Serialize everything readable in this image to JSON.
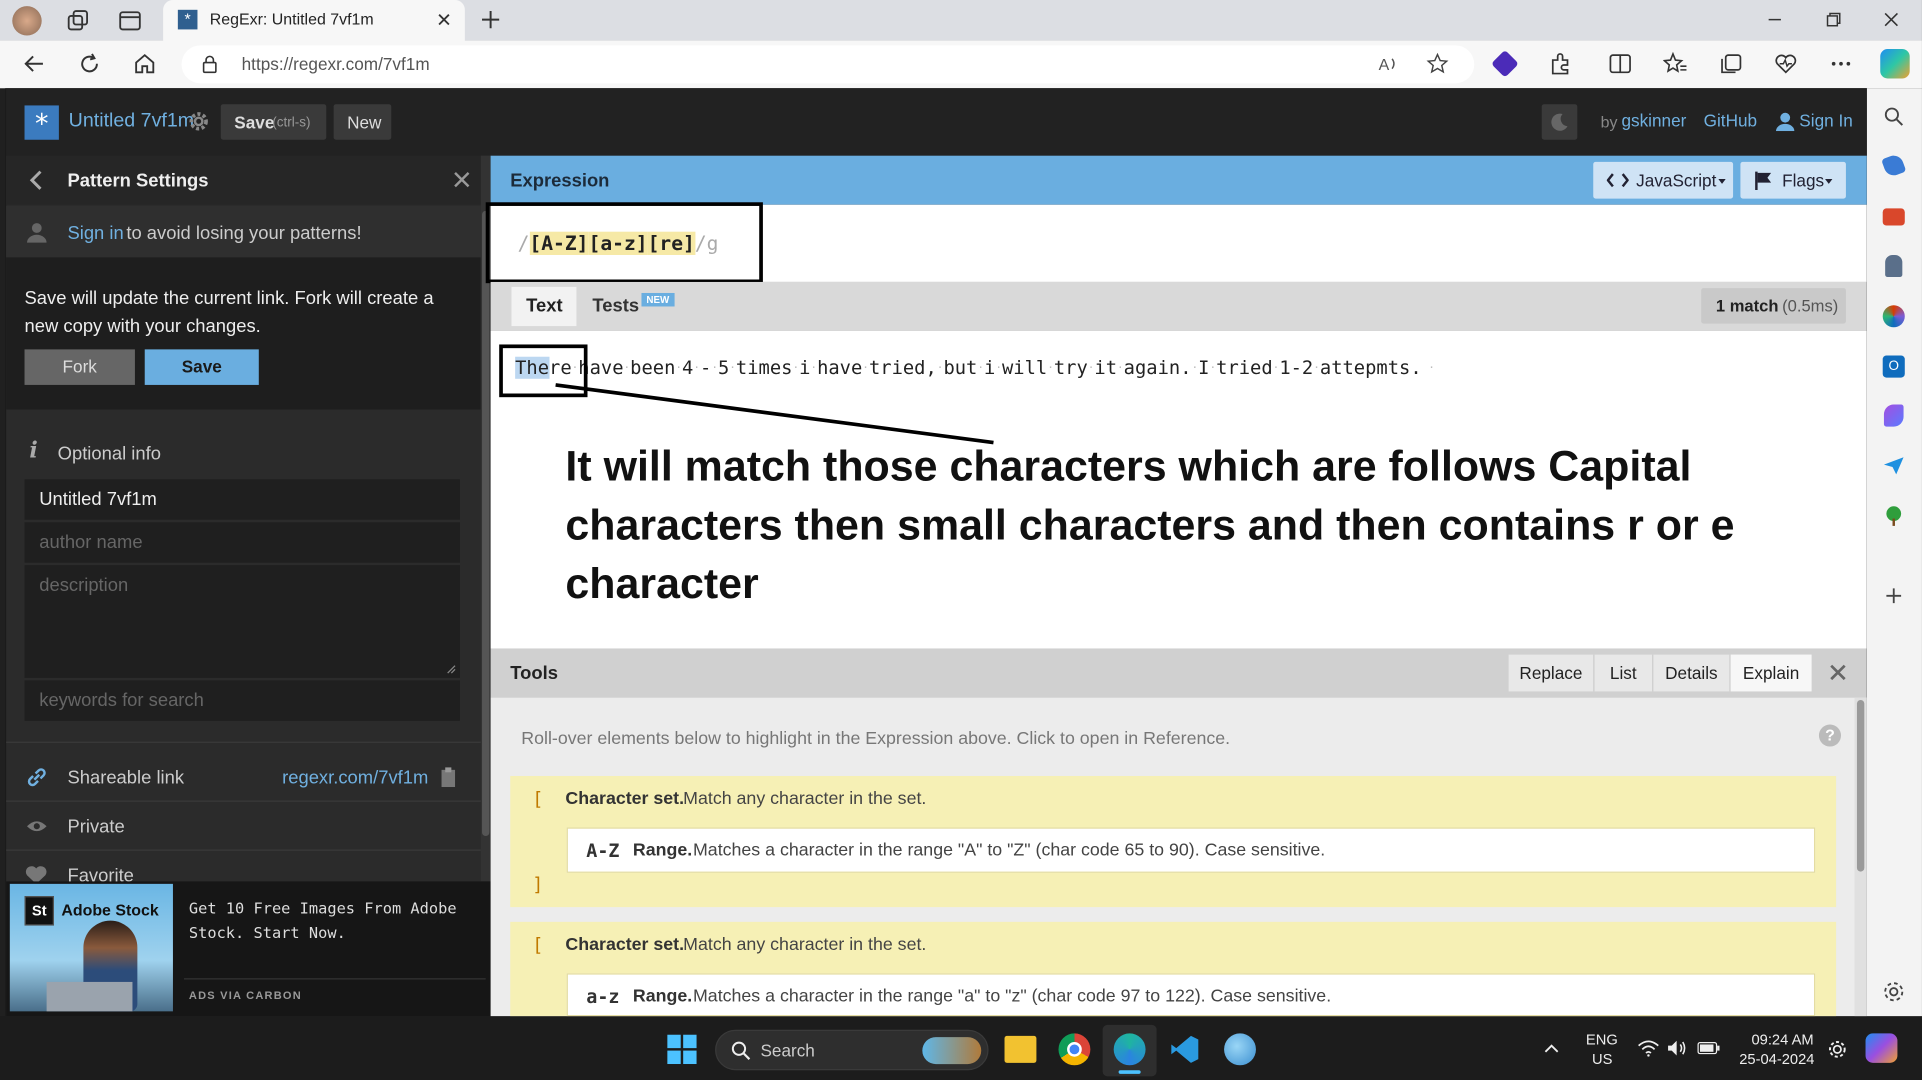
{
  "browser": {
    "tab_title": "RegExr: Untitled 7vf1m",
    "url": "https://regexr.com/7vf1m"
  },
  "header": {
    "doc_title": "Untitled 7vf1m",
    "save_label": "Save",
    "save_hint": "(ctrl-s)",
    "new_label": "New",
    "by_label": "by",
    "author": "gskinner",
    "github": "GitHub",
    "signin": "Sign In"
  },
  "sidebar": {
    "title": "Pattern Settings",
    "signin_link": "Sign in",
    "signin_text": "to avoid losing your patterns!",
    "note": "Save will update the current link. Fork will create a new copy with your changes.",
    "fork": "Fork",
    "save": "Save",
    "optional_info": "Optional info",
    "name_value": "Untitled 7vf1m",
    "author_placeholder": "author name",
    "description_placeholder": "description",
    "keywords_placeholder": "keywords for search",
    "shareable_label": "Shareable link",
    "shareable_url": "regexr.com/7vf1m",
    "private_label": "Private",
    "favorite_label": "Favorite"
  },
  "ad": {
    "brand": "Adobe Stock",
    "badge": "St",
    "text": "Get 10 Free Images From Adobe Stock. Start Now.",
    "footer": "ADS VIA CARBON"
  },
  "expression": {
    "header": "Expression",
    "lang": "JavaScript",
    "flags_label": "Flags",
    "open": "/",
    "tok1": "[A-Z]",
    "tok2": "[a-z]",
    "tok3": "[re]",
    "close": "/",
    "flag": "g"
  },
  "text_panel": {
    "tab_text": "Text",
    "tab_tests": "Tests",
    "new_badge": "NEW",
    "match_count": "1 match",
    "match_time": "(0.5ms)",
    "match": "The",
    "rest": "re have been 4 - 5 times i have tried, but i will try it again. I tried 1-2 attepmts.",
    "annotation": "It will match those characters which are follows Capital characters then small characters and then contains r or e character"
  },
  "tools": {
    "header": "Tools",
    "tabs": [
      "Replace",
      "List",
      "Details",
      "Explain"
    ],
    "hint": "Roll-over elements below to highlight in the Expression above. Click to open in Reference.",
    "set_open": "[",
    "set_close": "]",
    "set_title": "Character set.",
    "set_desc": "Match any character in the set.",
    "range1_token": "A-Z",
    "range_title": "Range.",
    "range1_desc": "Matches a character in the range \"A\" to \"Z\" (char code 65 to 90). Case sensitive.",
    "range2_token": "a-z",
    "range2_desc": "Matches a character in the range \"a\" to \"z\" (char code 97 to 122). Case sensitive."
  },
  "taskbar": {
    "search": "Search",
    "lang1": "ENG",
    "lang2": "US",
    "time": "09:24 AM",
    "date": "25-04-2024"
  },
  "colors": {
    "app_bg": "#2b2b2b",
    "accent_blue": "#6aaee0",
    "link_blue": "#70b0e0",
    "explain_bg": "#f6f0b5",
    "match_bg": "#bcd7f1"
  }
}
